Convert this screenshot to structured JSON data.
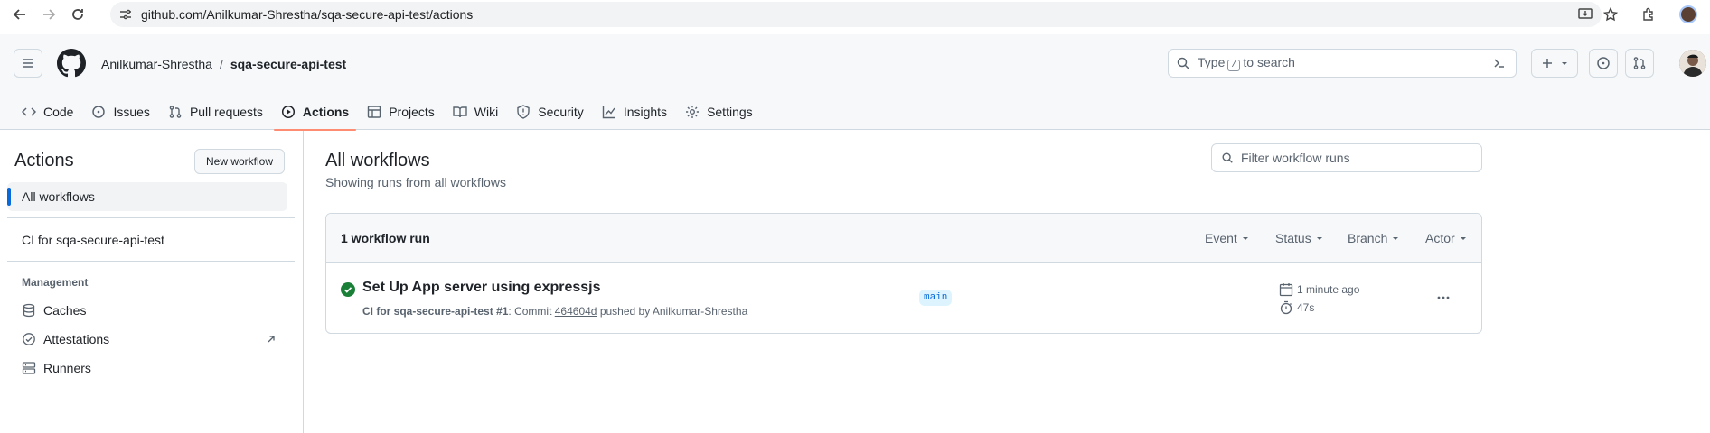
{
  "browser": {
    "url": "github.com/Anilkumar-Shrestha/sqa-secure-api-test/actions"
  },
  "header": {
    "owner": "Anilkumar-Shrestha",
    "separator": "/",
    "repo": "sqa-secure-api-test",
    "search_pre": "Type",
    "search_key": "/",
    "search_post": "to search",
    "plus_label": "+"
  },
  "tabs": [
    {
      "label": "Code",
      "icon": "code-icon"
    },
    {
      "label": "Issues",
      "icon": "issue-icon"
    },
    {
      "label": "Pull requests",
      "icon": "pull-request-icon"
    },
    {
      "label": "Actions",
      "icon": "play-icon",
      "active": true
    },
    {
      "label": "Projects",
      "icon": "table-icon"
    },
    {
      "label": "Wiki",
      "icon": "book-icon"
    },
    {
      "label": "Security",
      "icon": "shield-icon"
    },
    {
      "label": "Insights",
      "icon": "graph-icon"
    },
    {
      "label": "Settings",
      "icon": "gear-icon"
    }
  ],
  "sidebar": {
    "title": "Actions",
    "new_workflow": "New workflow",
    "all_workflows": "All workflows",
    "workflow": "CI for sqa-secure-api-test",
    "management_heading": "Management",
    "management": [
      {
        "label": "Caches",
        "icon": "database-icon"
      },
      {
        "label": "Attestations",
        "icon": "verified-icon"
      },
      {
        "label": "Runners",
        "icon": "server-icon"
      }
    ]
  },
  "main": {
    "title": "All workflows",
    "subtitle": "Showing runs from all workflows",
    "filter_placeholder": "Filter workflow runs",
    "count_label": "1 workflow run",
    "filters": [
      "Event",
      "Status",
      "Branch",
      "Actor"
    ],
    "run": {
      "title": "Set Up App server using expressjs",
      "workflow": "CI for sqa-secure-api-test",
      "number": "#1",
      "meta_mid": ": Commit",
      "sha": "464604d",
      "meta_end": "pushed by Anilkumar-Shrestha",
      "branch": "main",
      "when": "1 minute ago",
      "duration": "47s",
      "status": "success"
    }
  },
  "colors": {
    "accent": "#0969da",
    "success": "#1a7f37",
    "tab_underline": "#fd8c73"
  }
}
